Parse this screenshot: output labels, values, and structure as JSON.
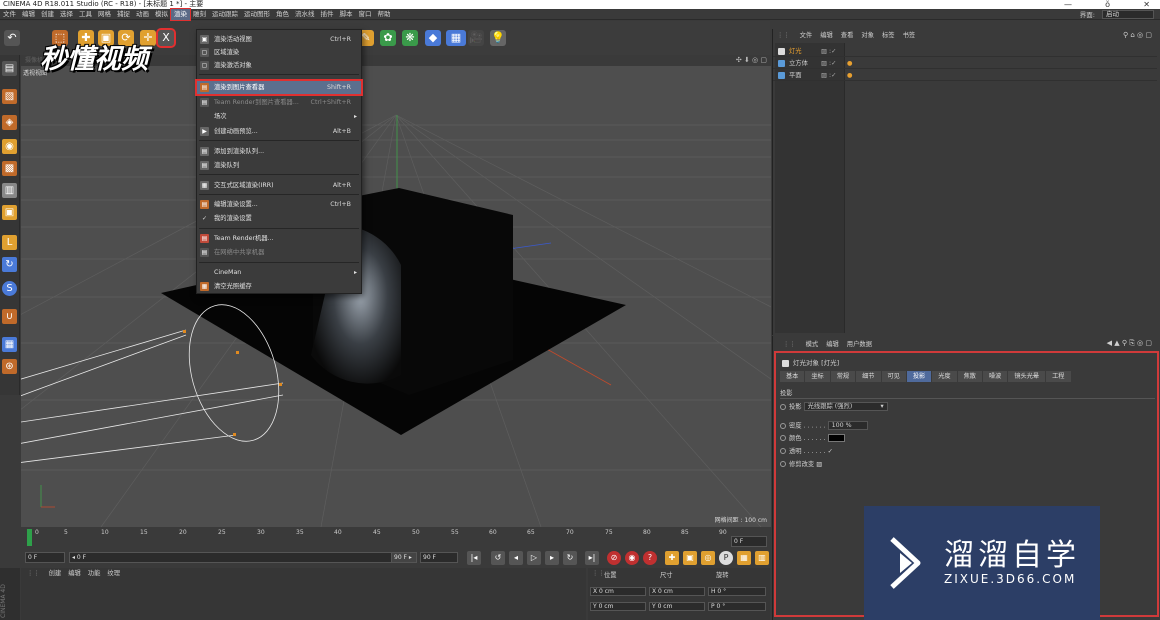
{
  "window": {
    "title": "CINEMA 4D R18.011 Studio (RC - R18) - [未标题 1 *] - 主要",
    "minimize": "—",
    "restore": "ŏ",
    "close": "✕"
  },
  "menubar": {
    "items": [
      "文件",
      "编辑",
      "创建",
      "选择",
      "工具",
      "网格",
      "捕捉",
      "动画",
      "模拟",
      "渲染",
      "雕刻",
      "运动跟踪",
      "运动图形",
      "角色",
      "流水线",
      "插件",
      "脚本",
      "窗口",
      "帮助"
    ],
    "active": "渲染",
    "layout_label": "界面:",
    "layout_value": "启动"
  },
  "viewport": {
    "tab": "摄像机 显示 选项 过滤 面板 ProRender",
    "view_name": "透视视图",
    "grid_info": "网格间距 : 100 cm",
    "nav_icons": "✣ ⬇ ◎ ▢"
  },
  "watermark": "秒懂视频",
  "render_menu": {
    "items": [
      {
        "label": "渲染活动视图",
        "shortcut": "Ctrl+R",
        "icon_name": "render-view-icon"
      },
      {
        "label": "区域渲染",
        "shortcut": "",
        "icon_name": "region-render-icon"
      },
      {
        "label": "渲染激活对象",
        "shortcut": "",
        "icon_name": "render-active-icon"
      },
      {
        "label": "渲染到图片查看器",
        "shortcut": "Shift+R",
        "icon_name": "picture-viewer-icon"
      },
      {
        "label": "Team Render到图片查看器...",
        "shortcut": "Ctrl+Shift+R",
        "icon_name": "team-render-icon"
      },
      {
        "label": "场次",
        "shortcut": "",
        "icon_name": ""
      },
      {
        "label": "创建动画预览...",
        "shortcut": "Alt+B",
        "icon_name": "preview-icon"
      },
      {
        "label": "添加到渲染队列...",
        "shortcut": "",
        "icon_name": "add-queue-icon"
      },
      {
        "label": "渲染队列",
        "shortcut": "",
        "icon_name": "queue-icon"
      },
      {
        "label": "交互式区域渲染(IRR)",
        "shortcut": "Alt+R",
        "icon_name": "irr-icon"
      },
      {
        "label": "编辑渲染设置...",
        "shortcut": "Ctrl+B",
        "icon_name": "render-settings-icon"
      },
      {
        "label": "我的渲染设置",
        "shortcut": "",
        "icon_name": "checkmark-icon"
      },
      {
        "label": "Team Render机器...",
        "shortcut": "",
        "icon_name": "team-machine-icon"
      },
      {
        "label": "在网络中共享机器",
        "shortcut": "",
        "icon_name": "share-icon"
      },
      {
        "label": "CineMan",
        "shortcut": "",
        "icon_name": ""
      },
      {
        "label": "清空光照缓存",
        "shortcut": "",
        "icon_name": "flush-cache-icon"
      }
    ]
  },
  "timeline": {
    "ticks": [
      "0",
      "5",
      "10",
      "15",
      "20",
      "25",
      "30",
      "35",
      "40",
      "45",
      "50",
      "55",
      "60",
      "65",
      "70",
      "75",
      "80",
      "85",
      "90"
    ],
    "current_frame_right": "0 F"
  },
  "playbar": {
    "start": "0 F",
    "min": "◂ 0 F",
    "max": "90 F ▸",
    "end": "90 F"
  },
  "material_panel": {
    "menu": [
      "创建",
      "编辑",
      "功能",
      "纹理"
    ],
    "side_logo": "CINEMA 4D"
  },
  "coords": {
    "headers": [
      "位置",
      "尺寸",
      "旋转"
    ],
    "rows": [
      {
        "a": "X  0 cm",
        "b": "X  0 cm",
        "c": "H  0 °"
      },
      {
        "a": "Y  0 cm",
        "b": "Y  0 cm",
        "c": "P  0 °"
      }
    ]
  },
  "object_manager": {
    "menu": [
      "文件",
      "编辑",
      "查看",
      "对象",
      "标签",
      "书签"
    ],
    "objects": [
      {
        "name": "灯光",
        "color": "#dcdcdc"
      },
      {
        "name": "立方体",
        "color": "#5a9ad8"
      },
      {
        "name": "平面",
        "color": "#5a9ad8"
      }
    ],
    "tag_mark": "▨ :✓",
    "tag_dots": "●"
  },
  "attributes": {
    "menu": [
      "模式",
      "编辑",
      "用户数据"
    ],
    "object_title": "灯光对象 [灯光]",
    "tabs": [
      "基本",
      "坐标",
      "常规",
      "细节",
      "可见",
      "投影",
      "光度",
      "焦散",
      "噪波",
      "镜头光晕",
      "工程"
    ],
    "active_tab": "投影",
    "section": "投影",
    "shadow_label": "投影",
    "shadow_value": "光线跟踪 (强烈)",
    "density_label": "密度 . . . . . .",
    "density_value": "100 %",
    "color_label": "颜色 . . . . . .",
    "transparency_label": "透明 . . . . . .",
    "transparency_value": "✓",
    "clip_label": "修剪改变",
    "clip_value": "▨"
  },
  "logo": {
    "zh": "溜溜自学",
    "en": "ZIXUE.3D66.COM"
  },
  "colors": {
    "accent": "#e03030",
    "highlight": "#5c6f8e",
    "tab_active": "#4f6a9c",
    "logo_bg": "#2c3e66"
  }
}
